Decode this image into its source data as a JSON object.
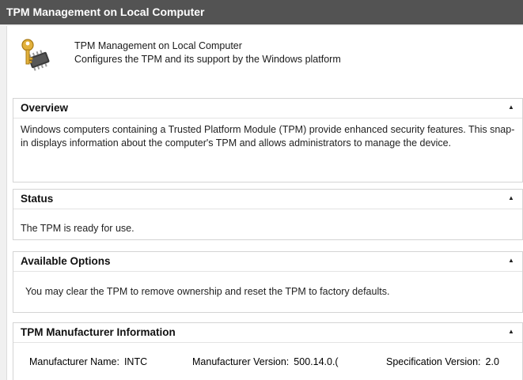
{
  "window": {
    "title": "TPM Management on Local Computer"
  },
  "header": {
    "icon": "tpm-key-chip-icon",
    "title": "TPM Management on Local Computer",
    "description": "Configures the TPM and its support by the Windows platform"
  },
  "sections": {
    "overview": {
      "title": "Overview",
      "text": "Windows computers containing a Trusted Platform Module (TPM) provide enhanced security features. This snap-in displays information about the computer's TPM and allows administrators to manage the device."
    },
    "status": {
      "title": "Status",
      "text": "The TPM is ready for use."
    },
    "available_options": {
      "title": "Available Options",
      "text": "You may clear the TPM to remove ownership and reset the TPM to factory defaults."
    },
    "manufacturer": {
      "title": "TPM Manufacturer Information",
      "name_label": "Manufacturer Name:",
      "name_value": "INTC",
      "version_label": "Manufacturer Version:",
      "version_value": "500.14.0.(",
      "spec_label": "Specification Version:",
      "spec_value": "2.0"
    }
  },
  "colors": {
    "title_bar": "#535353",
    "panel_bg": "#ffffff",
    "border": "#d4d4d4"
  }
}
